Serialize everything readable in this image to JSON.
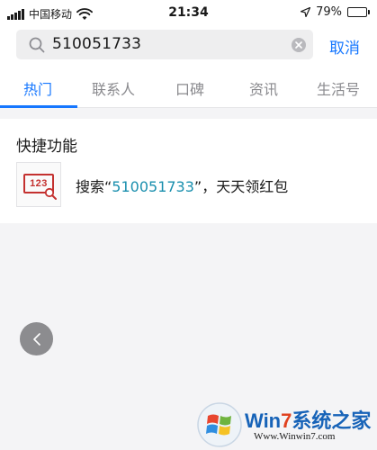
{
  "status_bar": {
    "carrier": "中国移动",
    "time": "21:34",
    "battery": "79%",
    "battery_level": 0.79
  },
  "search": {
    "query": "510051733",
    "cancel_label": "取消"
  },
  "tabs": [
    {
      "label": "热门",
      "active": true
    },
    {
      "label": "联系人",
      "active": false
    },
    {
      "label": "口碑",
      "active": false
    },
    {
      "label": "资讯",
      "active": false
    },
    {
      "label": "生活号",
      "active": false
    }
  ],
  "quick_functions": {
    "title": "快捷功能",
    "icon_text": "123",
    "item": {
      "prefix": "搜索“",
      "highlight": "510051733",
      "suffix": "”，天天领红包"
    }
  },
  "watermark": {
    "brand_w": "Win",
    "brand_7": "7",
    "brand_rest": "系统之家",
    "url": "Www.Winwin7.com"
  },
  "colors": {
    "accent": "#1677ff",
    "highlight": "#1a8fae",
    "icon_red": "#c4312f"
  }
}
